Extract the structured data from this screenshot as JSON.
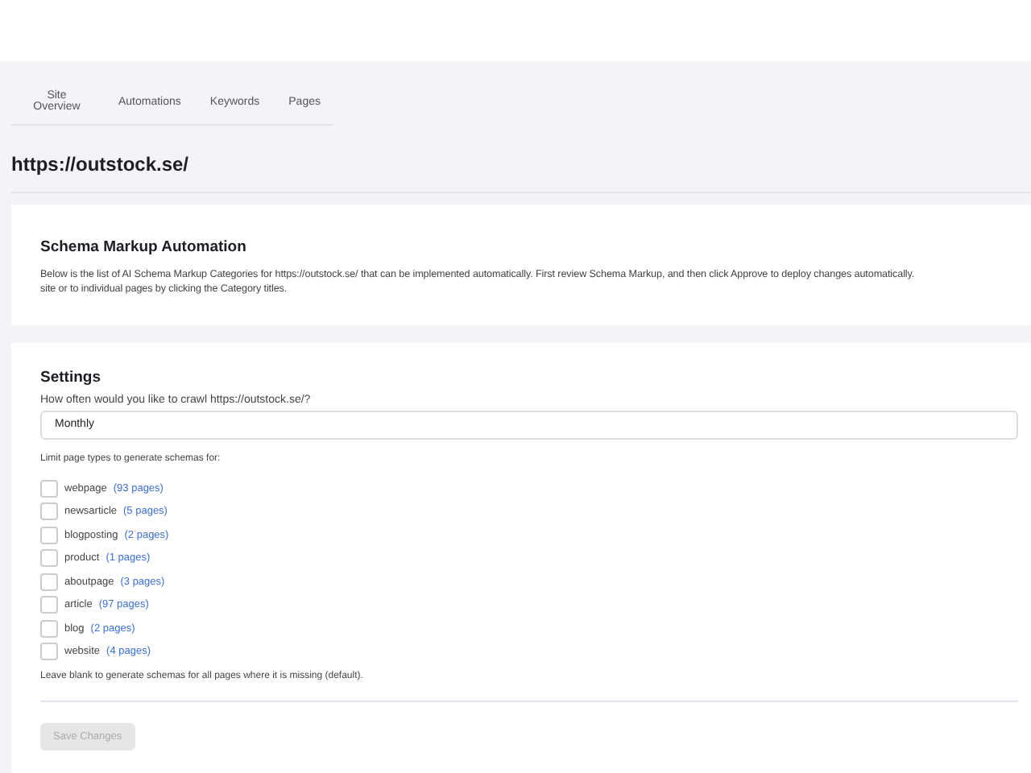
{
  "tabs": [
    {
      "label": "Site Overview",
      "selected": false
    },
    {
      "label": "Automations",
      "selected": false
    },
    {
      "label": "Keywords",
      "selected": false
    },
    {
      "label": "Pages",
      "selected": false
    }
  ],
  "site_url": "https://outstock.se/",
  "intro_card": {
    "title": "Schema Markup Automation",
    "lines": [
      "Below is the list of AI Schema Markup Categories for https://outstock.se/ that can be implemented automatically. First review Schema Markup, and then click Approve to deploy changes automatically.",
      "site or to individual pages by clicking the Category titles."
    ]
  },
  "settings": {
    "title": "Settings",
    "crawl_label": "How often would you like to crawl https://outstock.se/?",
    "crawl_value": "Monthly",
    "limit_label": "Limit page types to generate schemas for:",
    "page_types": [
      {
        "name": "webpage",
        "count": "(93 pages)",
        "checked": false
      },
      {
        "name": "newsarticle",
        "count": "(5 pages)",
        "checked": false
      },
      {
        "name": "blogposting",
        "count": "(2 pages)",
        "checked": false
      },
      {
        "name": "product",
        "count": "(1 pages)",
        "checked": false
      },
      {
        "name": "aboutpage",
        "count": "(3 pages)",
        "checked": false
      },
      {
        "name": "article",
        "count": "(97 pages)",
        "checked": false
      },
      {
        "name": "blog",
        "count": "(2 pages)",
        "checked": false
      },
      {
        "name": "website",
        "count": "(4 pages)",
        "checked": false
      }
    ],
    "hint": "Leave blank to generate schemas for all pages where it is missing (default).",
    "save_button": {
      "label": "Save Changes",
      "disabled": true
    }
  }
}
